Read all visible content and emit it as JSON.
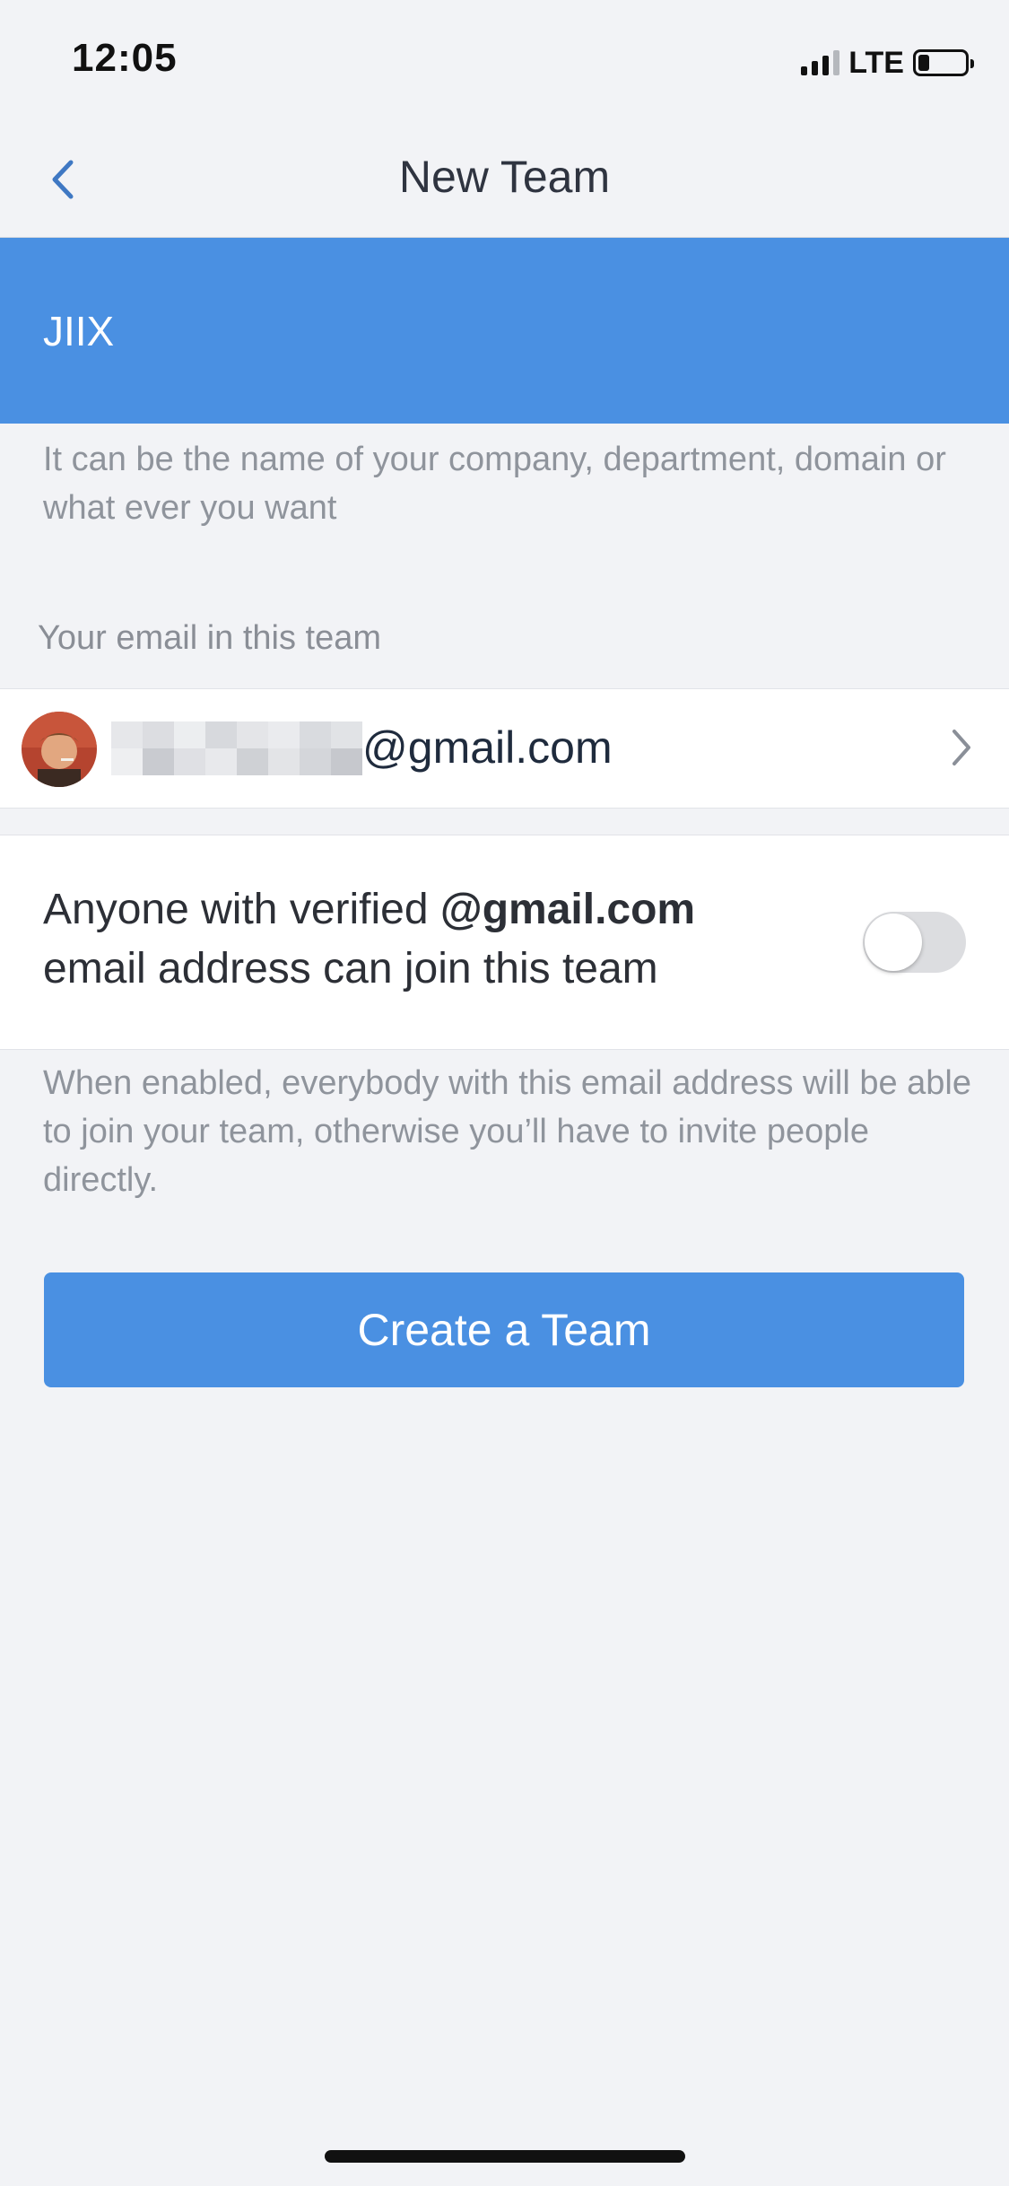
{
  "status_bar": {
    "time": "12:05",
    "network": "LTE",
    "signal_bars": 3,
    "battery_level_fraction": 0.2
  },
  "nav": {
    "title": "New Team",
    "back_icon": "chevron-left-icon"
  },
  "team_name": {
    "value": "JIIX",
    "helper": "It can be the name of your company, department, domain or what ever you want"
  },
  "email_section": {
    "label": "Your email in this team",
    "email_domain": "@gmail.com",
    "avatar": "avatar",
    "chevron_icon": "chevron-right-icon"
  },
  "join_toggle": {
    "text_prefix": "Anyone with verified ",
    "domain": "@gmail.com",
    "text_suffix": "email address can join this team",
    "enabled": false,
    "helper": "When enabled, everybody with this email address will be able to join your team, otherwise you’ll have to invite people directly."
  },
  "create_button": {
    "label": "Create a Team"
  },
  "colors": {
    "accent": "#4a90e2",
    "background": "#f2f3f6",
    "helper_text": "#8f949c"
  }
}
